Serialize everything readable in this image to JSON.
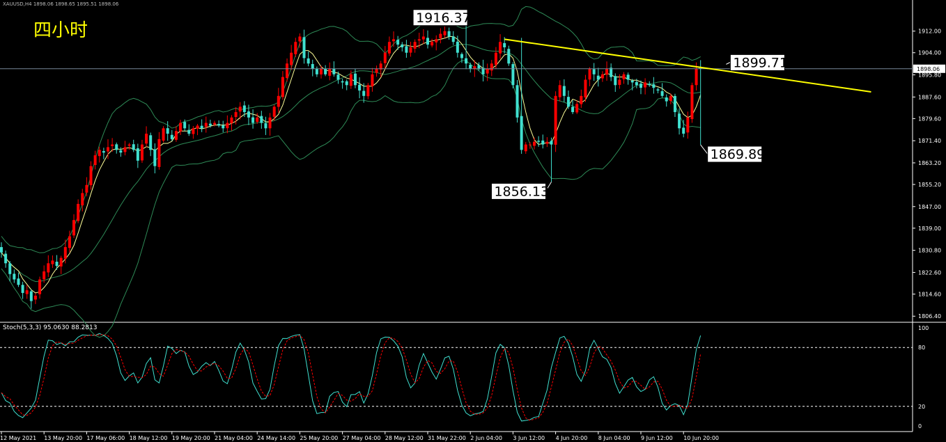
{
  "header": {
    "symbol": "XAUUSD,H4  1898.06 1898.65 1895.51 1898.06",
    "period_label": "四小时"
  },
  "colors": {
    "background": "#000000",
    "bull": "#ff0000",
    "bear": "#40e0d0",
    "band": "#2e8b57",
    "ma": "#ffff99",
    "trendline": "#ffff00",
    "stoch_main": "#40e0d0",
    "stoch_signal": "#ff0000",
    "axis_text": "#ffffff",
    "annotation_bg": "#ffffff",
    "annotation_text": "#000000"
  },
  "annotations": [
    {
      "name": "high",
      "text": "1916.37",
      "price": 1916.37,
      "index": 109
    },
    {
      "name": "low",
      "text": "1856.13",
      "price": 1856.13,
      "index": 129
    },
    {
      "name": "recent-low",
      "text": "1869.89",
      "price": 1869.89,
      "index": 164
    },
    {
      "name": "current",
      "text": "1899.71",
      "price": 1899.71,
      "index": 170
    }
  ],
  "current_price": "1898.06",
  "stoch": {
    "label": "Stoch(5,3,3) 95.0630 88.2813",
    "levels": [
      80,
      20
    ],
    "ticks": [
      "100",
      "80",
      "20",
      "0"
    ]
  },
  "chart_data": {
    "type": "candlestick",
    "y_ticks": [
      "1912.00",
      "1904.00",
      "1895.80",
      "1887.60",
      "1879.60",
      "1871.40",
      "1863.20",
      "1855.20",
      "1847.00",
      "1839.00",
      "1830.80",
      "1822.60",
      "1814.60",
      "1806.40"
    ],
    "ylim": [
      1804.4,
      1922.5
    ],
    "x_labels": [
      {
        "text": "12 May 2021",
        "index": 0
      },
      {
        "text": "13 May 20:00",
        "index": 10
      },
      {
        "text": "17 May 06:00",
        "index": 20
      },
      {
        "text": "18 May 12:00",
        "index": 30
      },
      {
        "text": "19 May 20:00",
        "index": 40
      },
      {
        "text": "21 May 04:00",
        "index": 50
      },
      {
        "text": "24 May 14:00",
        "index": 60
      },
      {
        "text": "25 May 20:00",
        "index": 70
      },
      {
        "text": "27 May 04:00",
        "index": 80
      },
      {
        "text": "28 May 12:00",
        "index": 90
      },
      {
        "text": "31 May 22:00",
        "index": 100
      },
      {
        "text": "2 Jun 04:00",
        "index": 110
      },
      {
        "text": "3 Jun 12:00",
        "index": 120
      },
      {
        "text": "4 Jun 20:00",
        "index": 130
      },
      {
        "text": "8 Jun 04:00",
        "index": 140
      },
      {
        "text": "9 Jun 12:00",
        "index": 150
      },
      {
        "text": "10 Jun 20:00",
        "index": 160
      }
    ],
    "trendline": {
      "from": {
        "index": 118,
        "price": 1909.0
      },
      "to": {
        "index": 204,
        "price": 1889.5
      }
    },
    "closes": [
      1830,
      1826,
      1822,
      1820,
      1818,
      1815,
      1816,
      1812,
      1814,
      1820,
      1823,
      1826,
      1827,
      1825,
      1828,
      1832,
      1836,
      1842,
      1848,
      1852,
      1855,
      1862,
      1866,
      1868,
      1867,
      1869,
      1870,
      1868,
      1867,
      1869,
      1870,
      1868,
      1864,
      1870,
      1874,
      1868,
      1862,
      1872,
      1876,
      1874,
      1872,
      1875,
      1878,
      1876,
      1874,
      1876,
      1877,
      1876,
      1878,
      1877,
      1878,
      1877,
      1876,
      1878,
      1880,
      1882,
      1884,
      1882,
      1880,
      1878,
      1880,
      1878,
      1876,
      1880,
      1884,
      1888,
      1895,
      1900,
      1904,
      1908,
      1910,
      1902,
      1900,
      1898,
      1896,
      1898,
      1896,
      1898,
      1896,
      1894,
      1893,
      1892,
      1896,
      1892,
      1890,
      1888,
      1892,
      1896,
      1898,
      1900,
      1904,
      1908,
      1909,
      1907,
      1906,
      1904,
      1906,
      1908,
      1909,
      1910,
      1907,
      1908,
      1909,
      1911,
      1912,
      1910,
      1908,
      1904,
      1902,
      1900,
      1898,
      1899,
      1898,
      1896,
      1898,
      1900,
      1904,
      1908,
      1906,
      1900,
      1892,
      1880,
      1868,
      1870,
      1870,
      1871,
      1871,
      1870,
      1871,
      1870,
      1888,
      1892,
      1888,
      1884,
      1882,
      1885,
      1888,
      1894,
      1898,
      1896,
      1894,
      1896,
      1898,
      1895,
      1892,
      1894,
      1896,
      1894,
      1893,
      1892,
      1891,
      1893,
      1892,
      1891,
      1890,
      1888,
      1886,
      1888,
      1882,
      1876,
      1874,
      1880,
      1892,
      1898,
      1898
    ]
  }
}
